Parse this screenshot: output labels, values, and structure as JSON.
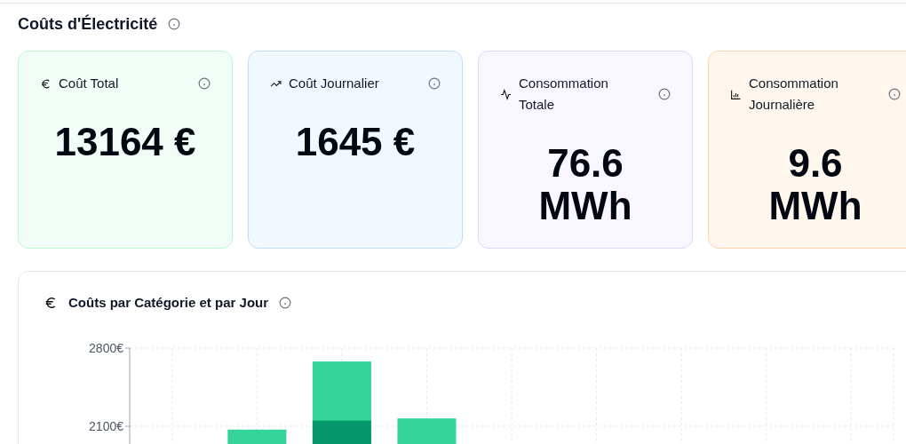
{
  "section": {
    "title": "Coûts d'Électricité"
  },
  "cards": [
    {
      "label": "Coût Total",
      "value": "13164 €",
      "color": "#bbf7d0"
    },
    {
      "label": "Coût Journalier",
      "value": "1645 €",
      "color": "#bfdbfe"
    },
    {
      "label": "Consommation Totale",
      "value": "76.6 MWh",
      "color": "#ddd6fe"
    },
    {
      "label": "Consommation Journalière",
      "value": "9.6 MWh",
      "color": "#fed7aa"
    }
  ],
  "chart_panel": {
    "title": "Coûts par Catégorie et par Jour",
    "chart_data": {
      "type": "bar",
      "stacked": false,
      "grid": true,
      "ylim": [
        1941,
        2800
      ],
      "yticks": [
        {
          "value": 2100,
          "label": "2100€"
        },
        {
          "value": 2800,
          "label": "2800€"
        }
      ],
      "series": [
        {
          "color": "#34d399",
          "values": [
            null,
            2070,
            2680,
            2170,
            null,
            null,
            null,
            null,
            null
          ]
        },
        {
          "color": "#059669",
          "values": [
            null,
            null,
            2150,
            null,
            null,
            null,
            null,
            null,
            null
          ]
        }
      ]
    }
  }
}
